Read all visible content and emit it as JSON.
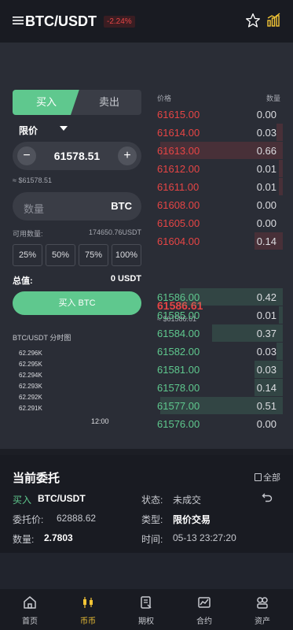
{
  "header": {
    "pair": "BTC/USDT",
    "change": "-2.24%",
    "icons": [
      "menu-icon",
      "star-icon",
      "chart-icon"
    ]
  },
  "trade": {
    "tab_buy": "买入",
    "tab_sell": "卖出",
    "order_type": "限价",
    "price": "61578.51",
    "minus_label": "−",
    "plus_label": "+",
    "price_approx": "≈ $61578.51",
    "qty_placeholder": "数量",
    "qty_unit": "BTC",
    "available_label": "可用数量:",
    "available_value": "174650.76USDT",
    "percents": [
      "25%",
      "50%",
      "75%",
      "100%"
    ],
    "total_label": "总值:",
    "total_value": "0 USDT",
    "buy_button": "买入 BTC"
  },
  "mini_chart": {
    "title": "BTC/USDT 分时图",
    "y_labels": [
      "62.296K",
      "62.295K",
      "62.294K",
      "62.293K",
      "62.292K",
      "62.291K"
    ],
    "x_label": "12:00"
  },
  "orderbook": {
    "price_header": "价格",
    "qty_header": "数量",
    "asks": [
      {
        "price": "61615.00",
        "qty": "0.00",
        "depth": 0.0
      },
      {
        "price": "61614.00",
        "qty": "0.03",
        "depth": 0.05
      },
      {
        "price": "61613.00",
        "qty": "0.66",
        "depth": 0.95
      },
      {
        "price": "61612.00",
        "qty": "0.01",
        "depth": 0.03
      },
      {
        "price": "61611.00",
        "qty": "0.01",
        "depth": 0.03
      },
      {
        "price": "61608.00",
        "qty": "0.00",
        "depth": 0.0
      },
      {
        "price": "61605.00",
        "qty": "0.00",
        "depth": 0.0
      },
      {
        "price": "61604.00",
        "qty": "0.14",
        "depth": 0.22
      }
    ],
    "last_price": "61586.61",
    "last_approx": "≈ $61586.61",
    "bids": [
      {
        "price": "61586.00",
        "qty": "0.42",
        "depth": 0.8
      },
      {
        "price": "61585.00",
        "qty": "0.01",
        "depth": 0.03
      },
      {
        "price": "61584.00",
        "qty": "0.37",
        "depth": 0.55
      },
      {
        "price": "61582.00",
        "qty": "0.03",
        "depth": 0.05
      },
      {
        "price": "61581.00",
        "qty": "0.03",
        "depth": 0.22
      },
      {
        "price": "61578.00",
        "qty": "0.14",
        "depth": 0.22
      },
      {
        "price": "61577.00",
        "qty": "0.51",
        "depth": 0.95
      },
      {
        "price": "61576.00",
        "qty": "0.00",
        "depth": 0.0
      }
    ]
  },
  "orders": {
    "title": "当前委托",
    "all_label": "全部",
    "side": "买入",
    "pair": "BTC/USDT",
    "status_label": "状态:",
    "status_value": "未成交",
    "price_label": "委托价:",
    "price_value": "62888.62",
    "type_label": "类型:",
    "type_value": "限价交易",
    "qty_label": "数量:",
    "qty_value": "2.7803",
    "time_label": "时间:",
    "time_value": "05-13 23:27:20"
  },
  "tabbar": {
    "items": [
      {
        "label": "首页",
        "icon": "home-icon"
      },
      {
        "label": "币币",
        "icon": "candles-icon",
        "active": true
      },
      {
        "label": "期权",
        "icon": "options-icon"
      },
      {
        "label": "合约",
        "icon": "contract-icon"
      },
      {
        "label": "资产",
        "icon": "assets-icon"
      }
    ]
  },
  "colors": {
    "green": "#5fc88e",
    "red": "#e64545",
    "gold": "#f3c536",
    "bg": "#21242d"
  }
}
